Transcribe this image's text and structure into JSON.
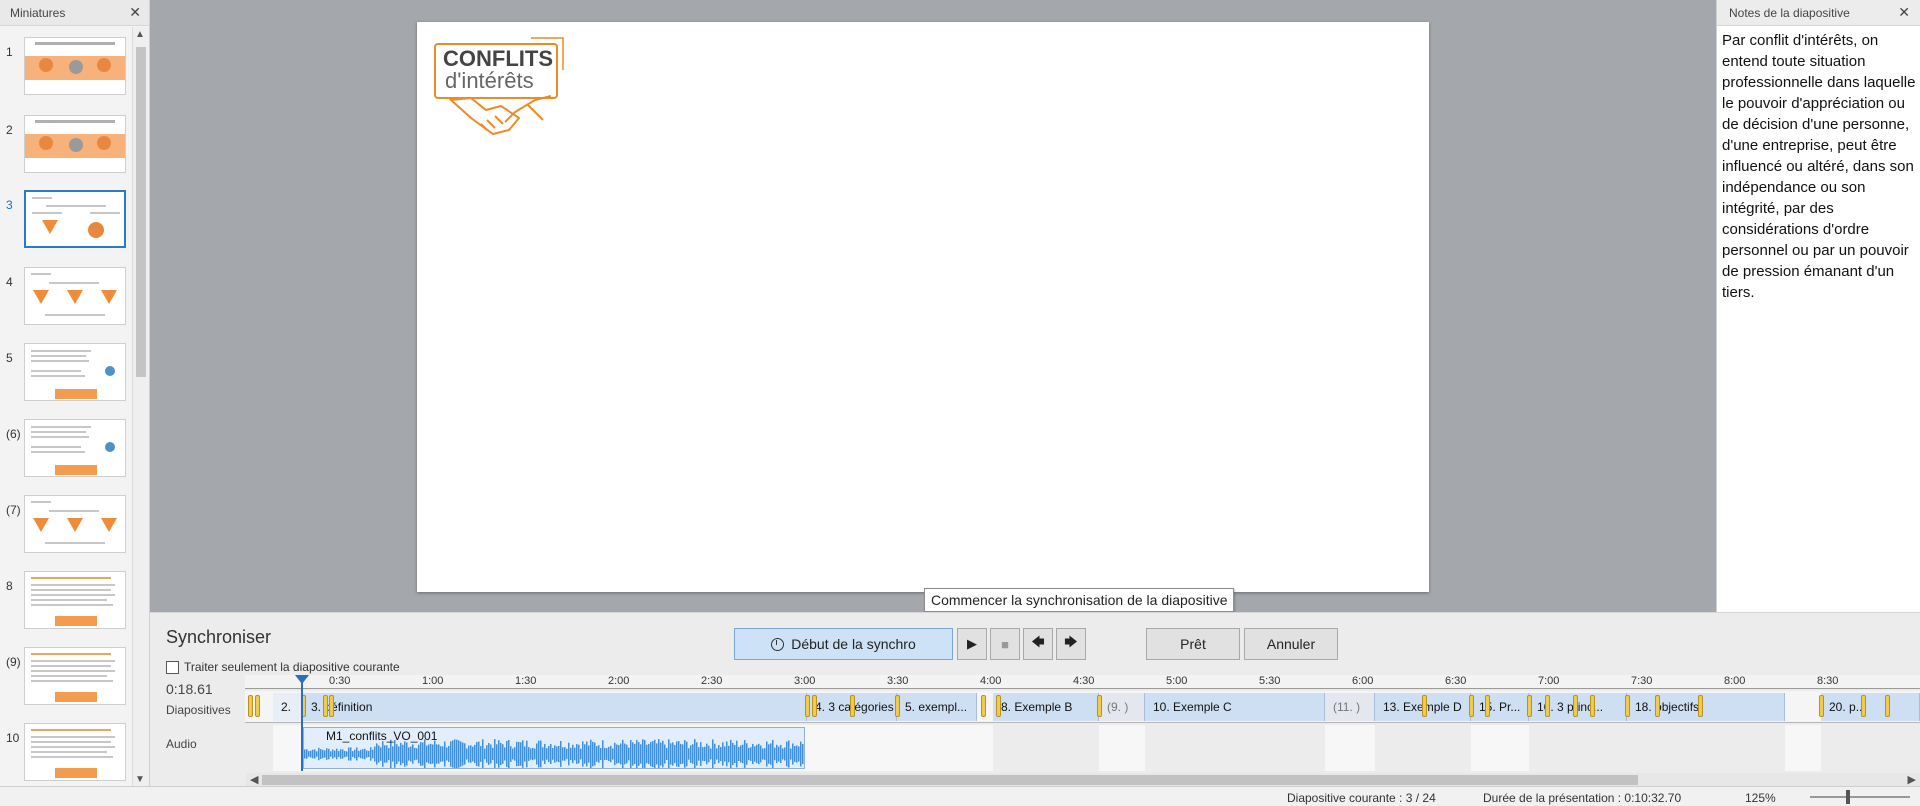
{
  "thumbnails_panel": {
    "title": "Miniatures",
    "items": [
      {
        "label": "1",
        "current": false
      },
      {
        "label": "2",
        "current": false
      },
      {
        "label": "3",
        "current": true
      },
      {
        "label": "4",
        "current": false
      },
      {
        "label": "5",
        "current": false
      },
      {
        "label": "(6)",
        "current": false
      },
      {
        "label": "(7)",
        "current": false
      },
      {
        "label": "8",
        "current": false
      },
      {
        "label": "(9)",
        "current": false
      },
      {
        "label": "10",
        "current": false
      }
    ]
  },
  "slide": {
    "logo_line1": "CONFLITS",
    "logo_line2": "d'intérêts",
    "brand_color": "#f08a24"
  },
  "tooltip": "Commencer la synchronisation de la diapositive",
  "notes_panel": {
    "title": "Notes de la diapositive",
    "text": "Par conflit d'intérêts, on entend toute situation professionnelle dans laquelle le pouvoir d'appréciation ou de décision d'une personne, d'une entreprise, peut être influencé ou altéré, dans son indépendance ou son intégrité, par des considérations d'ordre personnel ou par un pouvoir de pression émanant d'un tiers."
  },
  "sync_panel": {
    "title": "Synchroniser",
    "start_button": "Début de la synchro",
    "play_icon": "play-icon",
    "stop_icon": "stop-icon",
    "prev_icon": "arrow-left-icon",
    "next_icon": "arrow-right-icon",
    "ready_button": "Prêt",
    "cancel_button": "Annuler",
    "checkbox_label": "Traiter seulement la diapositive courante",
    "checkbox_checked": false,
    "current_time": "0:18.61",
    "row_slides": "Diapositives",
    "row_audio": "Audio"
  },
  "timeline": {
    "ticks": [
      "0:30",
      "1:00",
      "1:30",
      "2:00",
      "2:30",
      "3:00",
      "3:30",
      "4:00",
      "4:30",
      "5:00",
      "5:30",
      "6:00",
      "6:30",
      "7:00",
      "7:30",
      "8:00",
      "8:30"
    ],
    "segments": [
      {
        "label": "2.",
        "skipped": false
      },
      {
        "label": "3. définition",
        "skipped": false
      },
      {
        "label": "4. 3 catégories",
        "skipped": false
      },
      {
        "label": "5. exempl...",
        "skipped": false
      },
      {
        "label": "8. Exemple B",
        "skipped": false
      },
      {
        "label": "(9. )",
        "skipped": true
      },
      {
        "label": "10. Exemple C",
        "skipped": false
      },
      {
        "label": "(11. )",
        "skipped": true
      },
      {
        "label": "13. Exemple D",
        "skipped": false
      },
      {
        "label": "15. Pr...",
        "skipped": false
      },
      {
        "label": "16. 3 princ...",
        "skipped": false
      },
      {
        "label": "18. objectifs",
        "skipped": false
      },
      {
        "label": "20. p...",
        "skipped": false
      }
    ],
    "audio_clip": "M1_conflits_VO_001",
    "waveform_color": "#3f8fdc"
  },
  "status_bar": {
    "slide": "Diapositive courante : 3 / 24",
    "duration": "Durée de la présentation : 0:10:32.70",
    "zoom": "125%"
  }
}
